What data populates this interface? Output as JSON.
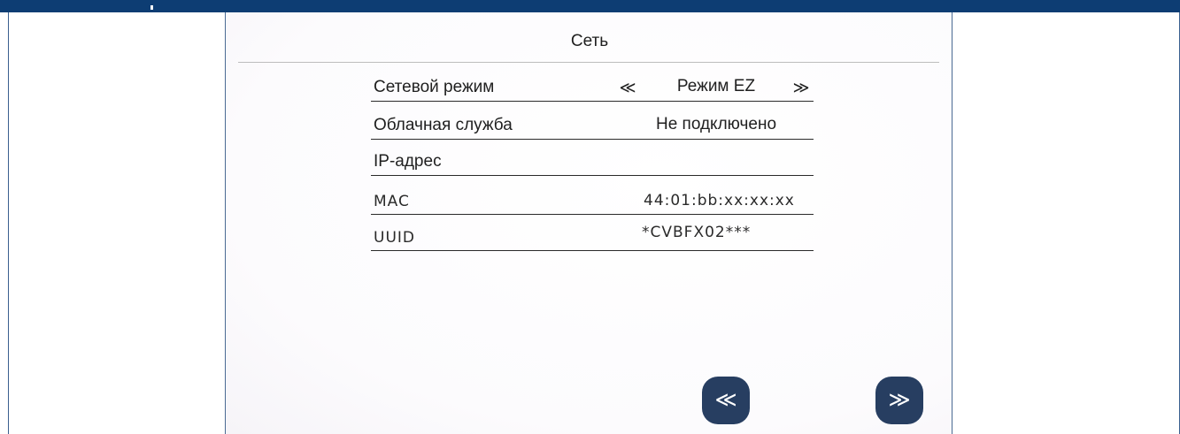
{
  "header": {
    "title": "Сеть"
  },
  "rows": [
    {
      "label": "Сетевой режим",
      "value": "Режим EZ",
      "prev_icon": "≪",
      "next_icon": "≫"
    },
    {
      "label": "Облачная служба",
      "value": "Не подключено"
    },
    {
      "label": "IP-адрес",
      "value": ""
    },
    {
      "label": "MAC",
      "value": "44:01:bb:xx:xx:xx"
    },
    {
      "label": "UUID",
      "value": "*CVBFX02***"
    }
  ],
  "nav": {
    "prev_icon": "≪",
    "next_icon": "≫"
  },
  "colors": {
    "top_bar": "#0d3d73",
    "nav_button": "#273e61"
  }
}
